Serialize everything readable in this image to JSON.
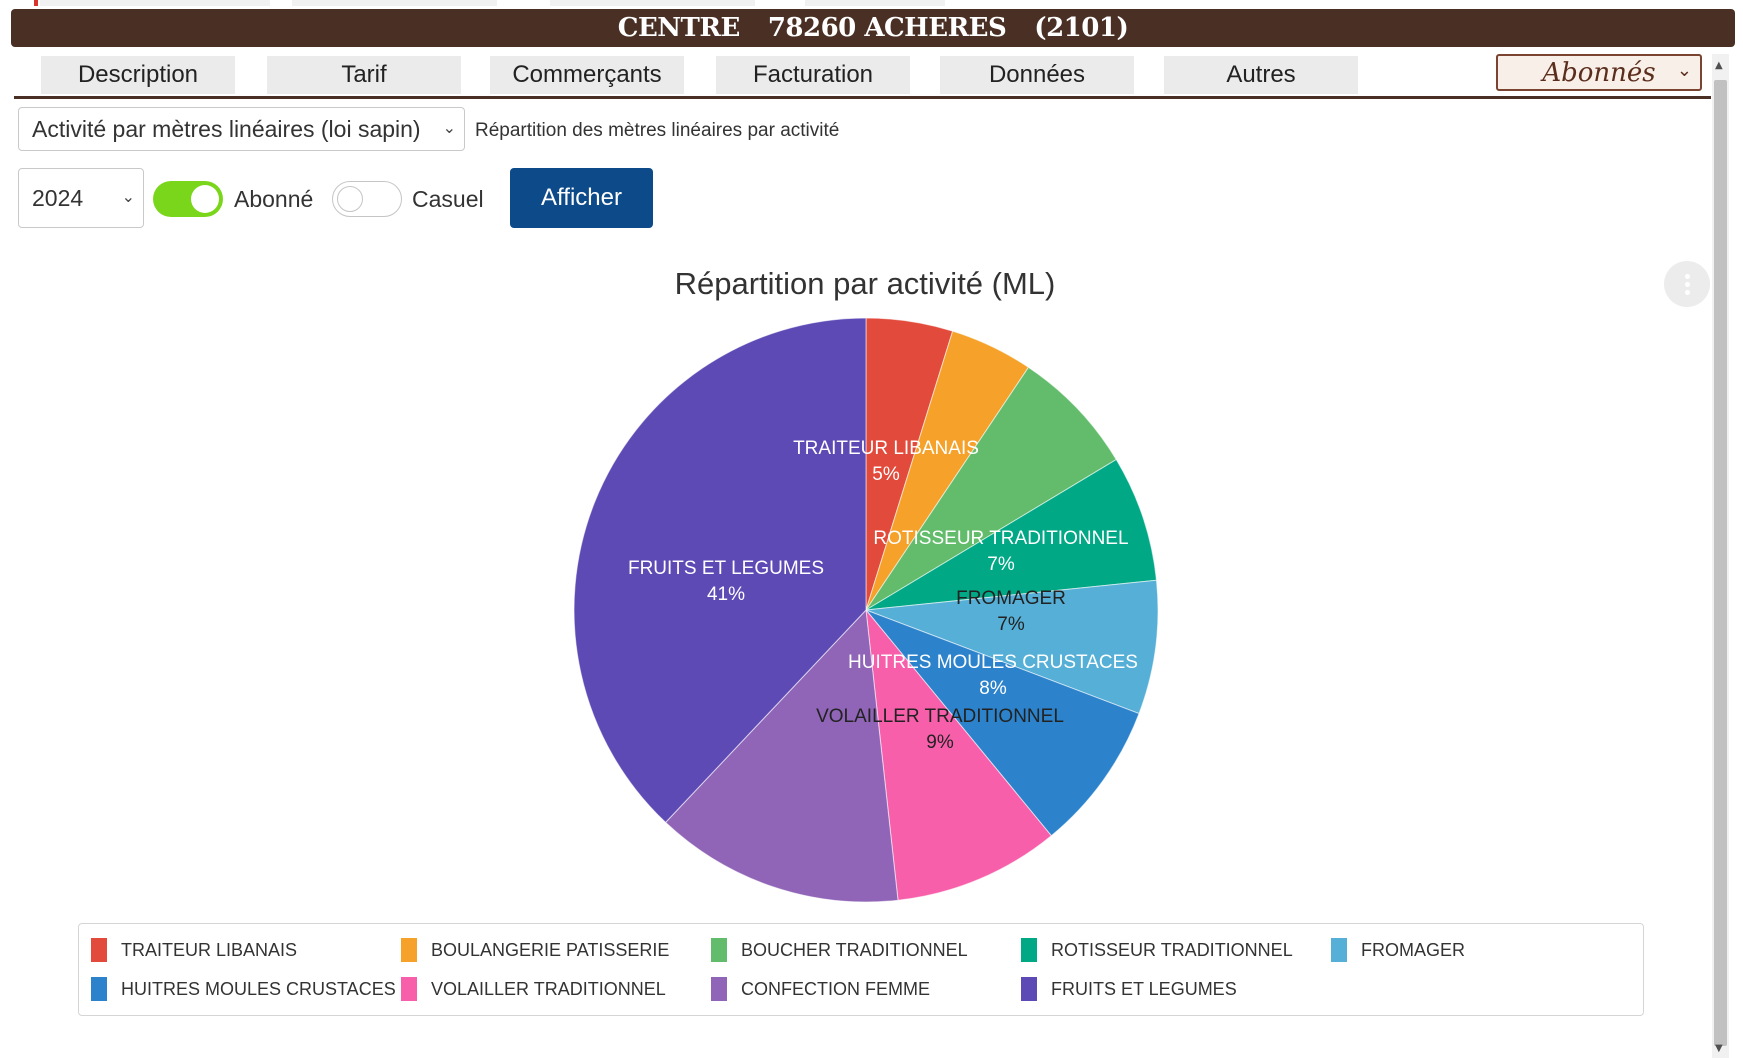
{
  "header": {
    "center": "CENTRE",
    "city": "78260 ACHERES",
    "code": "(2101)"
  },
  "nav": {
    "tabs": [
      {
        "label": "Description"
      },
      {
        "label": "Tarif"
      },
      {
        "label": "Commerçants"
      },
      {
        "label": "Facturation"
      },
      {
        "label": "Données"
      },
      {
        "label": "Autres"
      }
    ],
    "subscriber_filter": "Abonnés"
  },
  "controls": {
    "report": "Activité par mètres linéaires (loi sapin)",
    "report_description": "Répartition des mètres linéaires par activité",
    "year": "2024",
    "toggle_subscriber": {
      "label": "Abonné",
      "on": true
    },
    "toggle_casual": {
      "label": "Casuel",
      "on": false
    },
    "show_button": "Afficher"
  },
  "chart_data": {
    "type": "pie",
    "title": "Répartition par activité (ML)",
    "categories": [
      "TRAITEUR LIBANAIS",
      "BOULANGERIE PATISSERIE",
      "BOUCHER TRADITIONNEL",
      "ROTISSEUR TRADITIONNEL",
      "FROMAGER",
      "HUITRES MOULES CRUSTACES",
      "VOLAILLER TRADITIONNEL",
      "CONFECTION FEMME",
      "FRUITS ET LEGUMES"
    ],
    "values": [
      4.8,
      4.6,
      7.0,
      7.0,
      7.4,
      8.3,
      9.2,
      13.8,
      38.0
    ],
    "slice_labels": [
      "5%",
      "",
      "",
      "7%",
      "7%",
      "8%",
      "9%",
      "",
      "41%"
    ],
    "colors": [
      "#e24b3b",
      "#f5a12a",
      "#62bc6b",
      "#00a886",
      "#56afd6",
      "#2c83cc",
      "#f75fab",
      "#9064b7",
      "#5e4ab5"
    ],
    "label_colors": [
      "#ffffff",
      "#ffffff",
      "#ffffff",
      "#ffffff",
      "#222222",
      "#ffffff",
      "#222222",
      "#ffffff",
      "#ffffff"
    ],
    "legend_position": "bottom"
  }
}
